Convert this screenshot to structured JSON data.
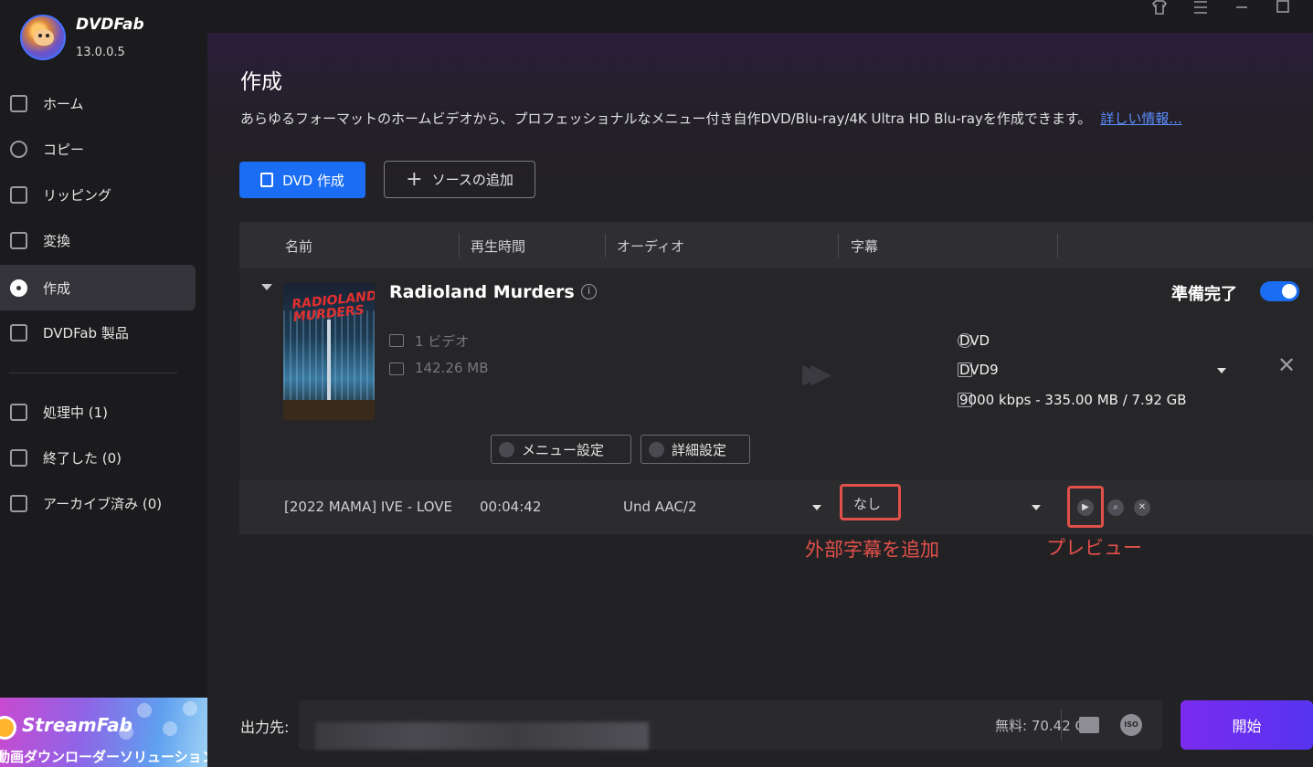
{
  "app": {
    "brand": "DVDFab",
    "version": "13.0.0.5"
  },
  "window_controls": [
    "shirt-icon",
    "menu-icon",
    "minimize-icon",
    "maximize-icon"
  ],
  "sidebar": {
    "items": [
      {
        "label": "ホーム",
        "icon": "home-icon"
      },
      {
        "label": "コピー",
        "icon": "copy-icon"
      },
      {
        "label": "リッピング",
        "icon": "ripper-icon"
      },
      {
        "label": "変換",
        "icon": "film-icon"
      },
      {
        "label": "作成",
        "icon": "disc-icon",
        "active": true
      },
      {
        "label": "DVDFab 製品",
        "icon": "products-icon"
      }
    ],
    "queue": [
      {
        "label": "処理中 (1)",
        "icon": "processing-icon"
      },
      {
        "label": "終了した (0)",
        "icon": "finished-icon"
      },
      {
        "label": "アーカイブ済み (0)",
        "icon": "archive-icon"
      }
    ],
    "promo": {
      "title": "StreamFab",
      "subtitle": "動画ダウンローダーソリューション"
    }
  },
  "main": {
    "title": "作成",
    "description": "あらゆるフォーマットのホームビデオから、プロフェッショナルなメニュー付き自作DVD/Blu-ray/4K Ultra HD Blu-rayを作成できます。",
    "more_link": "詳しい情報...",
    "dvd_create_button": "DVD 作成",
    "add_source_button": "ソースの追加",
    "table_headers": [
      "名前",
      "再生時間",
      "オーディオ",
      "字幕"
    ],
    "item": {
      "title": "Radioland Murders",
      "poster_text": "RADIOLAND MURDERS",
      "video_count": "1 ビデオ",
      "size": "142.26 MB",
      "status": "準備完了",
      "toggle_on": true,
      "output_format": "DVD",
      "disc_type": "DVD9",
      "bitrate_info": "9000 kbps - 335.00 MB / 7.92 GB",
      "menu_settings_button": "メニュー設定",
      "advanced_settings_button": "詳細設定"
    },
    "title_row": {
      "name": "[2022 MAMA] IVE - LOVE",
      "duration": "00:04:42",
      "audio": "Und  AAC/2",
      "subtitle": "なし"
    },
    "annotations": {
      "subtitle_note": "外部字幕を追加",
      "preview_note": "プレビュー"
    }
  },
  "footer": {
    "output_label": "出力先:",
    "free_space": "無料:  70.42 GB",
    "start_button": "開始"
  },
  "colors": {
    "accent_blue": "#1b6ef3",
    "annotation_red": "#e2504a",
    "start_purple": "#7a2cf0"
  }
}
